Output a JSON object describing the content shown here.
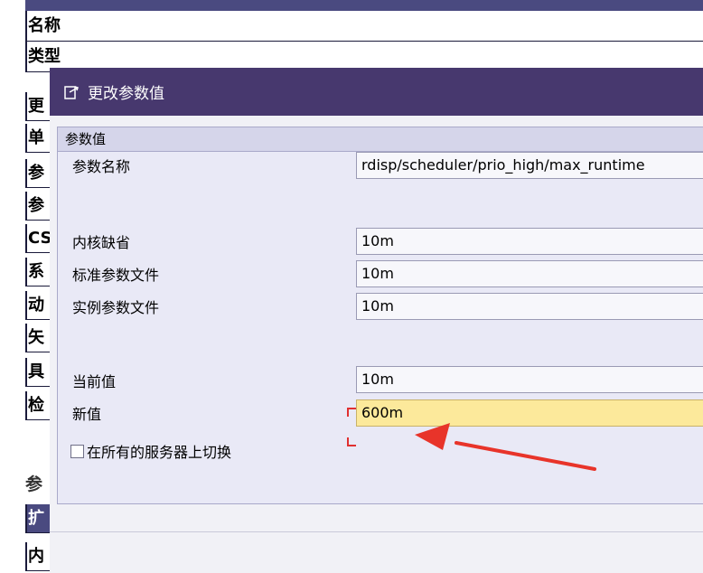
{
  "background": {
    "rows": [
      "名称",
      "类型"
    ],
    "side_rows": [
      "更",
      "单",
      "参",
      "参",
      "CS",
      "系",
      "动",
      "矢",
      "具",
      "检"
    ],
    "section_label": "参",
    "bottom_rows": [
      "扩",
      "内"
    ]
  },
  "dialog": {
    "title": "更改参数值",
    "title_icon": "edit-dialog-icon",
    "group_title": "参数值",
    "fields": {
      "param_name": {
        "label": "参数名称",
        "value": "rdisp/scheduler/prio_high/max_runtime"
      },
      "kernel_default": {
        "label": "内核缺省",
        "value": "10m"
      },
      "default_profile": {
        "label": "标准参数文件",
        "value": "10m"
      },
      "instance_profile": {
        "label": "实例参数文件",
        "value": "10m"
      },
      "current_value": {
        "label": "当前值",
        "value": "10m"
      },
      "new_value": {
        "label": "新值",
        "value": "600m"
      }
    },
    "switch_all": {
      "label": "在所有的服务器上切换",
      "checked": false
    }
  },
  "colors": {
    "titlebar": "#47386e",
    "editable_field": "#fce99b",
    "annotation_arrow": "#e8342a"
  }
}
